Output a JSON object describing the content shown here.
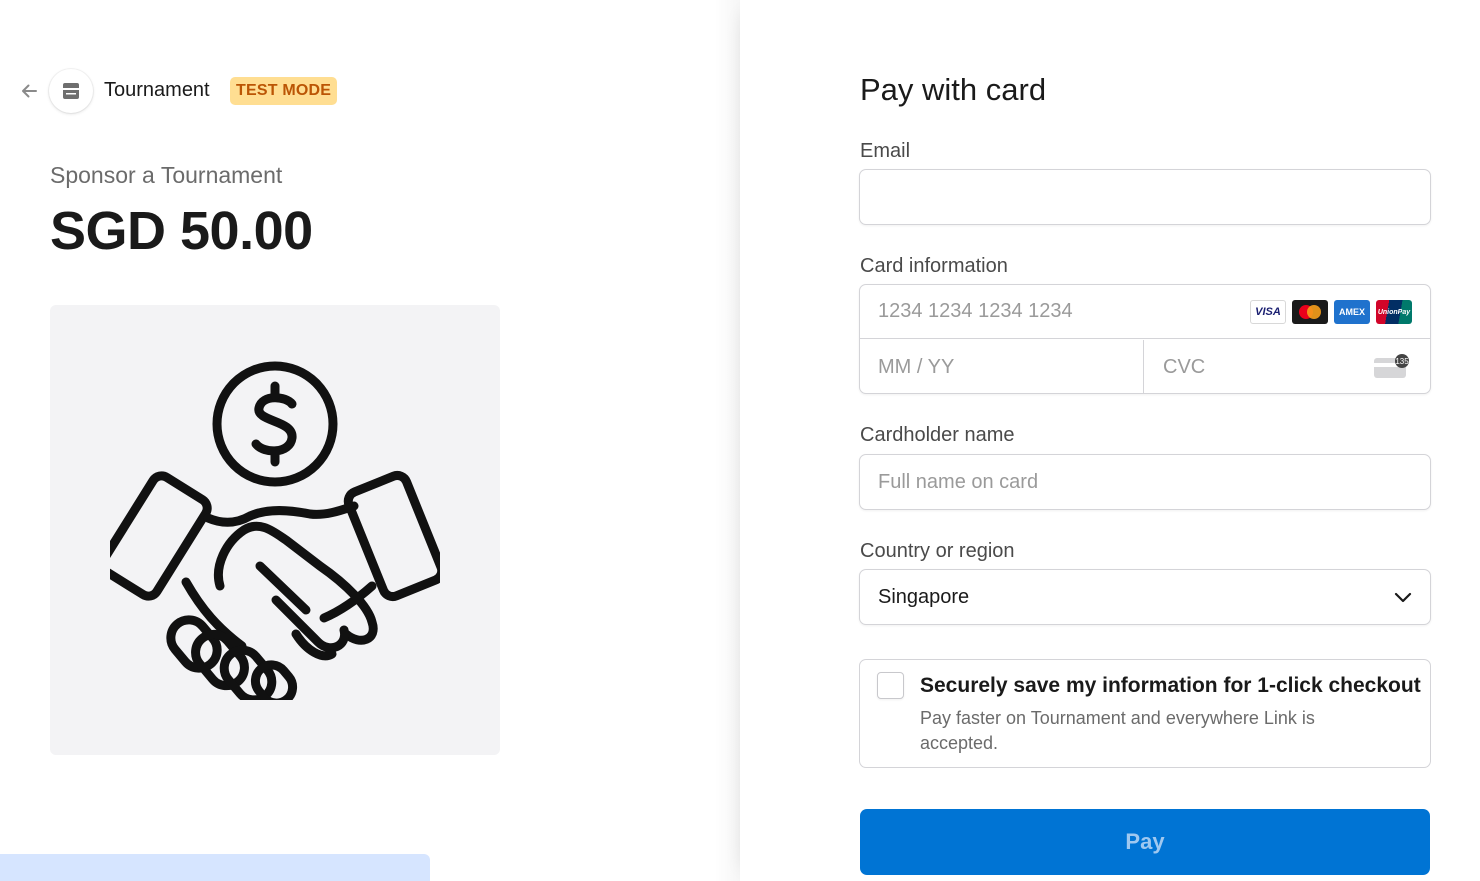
{
  "header": {
    "merchant_name": "Tournament",
    "badge": "TEST MODE"
  },
  "product": {
    "name": "Sponsor a Tournament",
    "price": "SGD 50.00",
    "image_icon": "handshake-dollar-icon"
  },
  "form": {
    "title": "Pay with card",
    "email": {
      "label": "Email",
      "value": "",
      "placeholder": ""
    },
    "card": {
      "label": "Card information",
      "number_placeholder": "1234 1234 1234 1234",
      "expiry_placeholder": "MM / YY",
      "cvc_placeholder": "CVC",
      "brands": [
        "VISA",
        "mastercard",
        "AMEX",
        "UnionPay"
      ],
      "cvc_hint": "135"
    },
    "cardholder": {
      "label": "Cardholder name",
      "placeholder": "Full name on card"
    },
    "country": {
      "label": "Country or region",
      "value": "Singapore"
    },
    "save": {
      "title": "Securely save my information for 1-click checkout",
      "subtitle": "Pay faster on Tournament and everywhere Link is accepted.",
      "checked": false
    },
    "pay_label": "Pay"
  },
  "colors": {
    "accent": "#0074d4",
    "badge_bg": "#ffde92",
    "badge_text": "#bb5504"
  }
}
